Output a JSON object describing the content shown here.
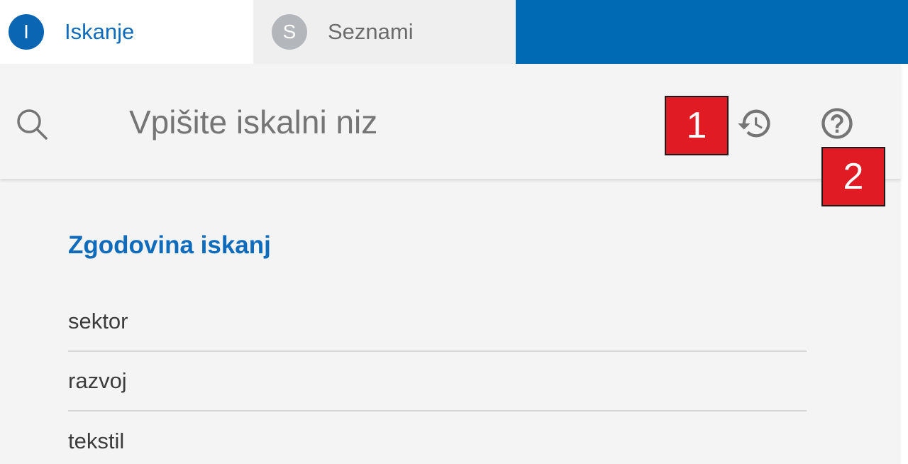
{
  "tabs": [
    {
      "icon_letter": "I",
      "label": "Iskanje"
    },
    {
      "icon_letter": "S",
      "label": "Seznami"
    }
  ],
  "search": {
    "placeholder": "Vpišite iskalni niz",
    "value": ""
  },
  "icons": {
    "search": "search-icon",
    "history": "history-icon",
    "help": "help-icon"
  },
  "annotations": {
    "badge1": "1",
    "badge2": "2"
  },
  "history": {
    "title": "Zgodovina iskanj",
    "items": [
      "sektor",
      "razvoj",
      "tekstil"
    ]
  },
  "colors": {
    "accent": "#0f6cbd",
    "tab_bar_blue": "#006bb5",
    "badge_red": "#e01b24",
    "panel_bg": "#f4f4f4"
  }
}
